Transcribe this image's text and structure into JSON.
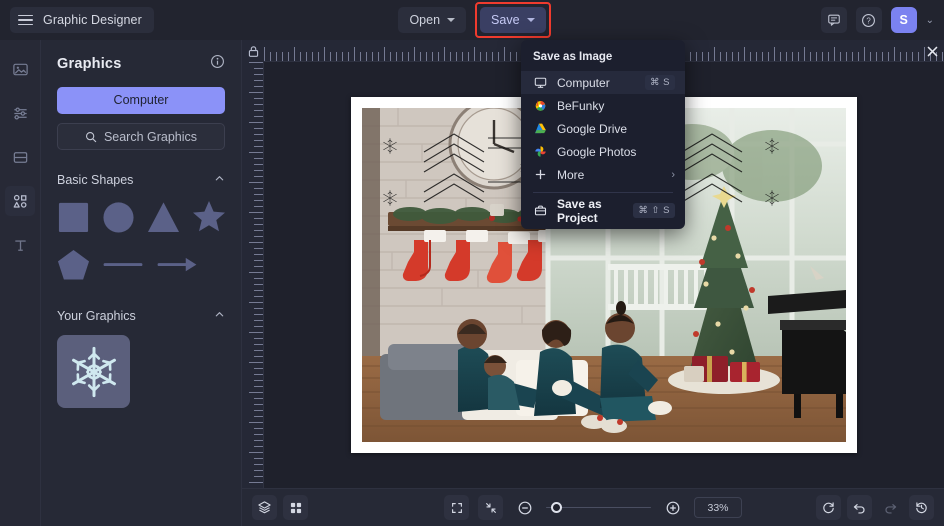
{
  "topbar": {
    "menu_icon": "hamburger-icon",
    "app_title": "Graphic Designer",
    "open_label": "Open",
    "save_label": "Save",
    "feedback_icon": "comment-icon",
    "help_icon": "question-circle-icon",
    "avatar_initial": "S",
    "avatar_caret": "⌄",
    "save_highlight_color": "#f03b2e",
    "save_button_bg": "#3a3f63"
  },
  "rail": {
    "items": [
      {
        "name": "image-tool",
        "icon": "image-icon"
      },
      {
        "name": "adjust-tool",
        "icon": "sliders-icon"
      },
      {
        "name": "frames-tool",
        "icon": "frame-icon"
      },
      {
        "name": "graphics-tool",
        "icon": "shapes-icon"
      },
      {
        "name": "text-tool",
        "icon": "text-icon"
      }
    ]
  },
  "panel": {
    "title": "Graphics",
    "info_icon": "info-icon",
    "computer_button": "Computer",
    "search_icon": "search-icon",
    "search_label": "Search Graphics",
    "sections": [
      {
        "title": "Basic Shapes",
        "chevron": "chevron-up-icon"
      },
      {
        "title": "Your Graphics",
        "chevron": "chevron-up-icon"
      }
    ],
    "basic_shapes": [
      "square-shape",
      "circle-shape",
      "triangle-shape",
      "star-shape",
      "pentagon-shape",
      "line-shape",
      "arrow-shape"
    ],
    "your_graphics": [
      {
        "name": "snowflake-graphic",
        "color": "#cfe8ef"
      }
    ],
    "shape_color": "#5b6188",
    "accent_color": "#8b92f8"
  },
  "ruler": {
    "lock_icon": "lock-icon",
    "close_icon": "close-icon"
  },
  "canvas": {
    "artboard_bg": "#ffffff",
    "photo_alt": "family-christmas-photo"
  },
  "bottombar": {
    "layers_icon": "layers-icon",
    "grid_icon": "grid-icon",
    "fit_icon": "expand-frame-icon",
    "shrink_icon": "collapse-arrows-icon",
    "zoom_out_icon": "minus-circle-icon",
    "zoom_in_icon": "plus-circle-icon",
    "zoom_value": "33%",
    "zoom_percent": 33,
    "reset_icon": "reset-icon",
    "undo_icon": "undo-icon",
    "redo_icon": "redo-icon",
    "history_icon": "history-icon"
  },
  "save_menu": {
    "header": "Save as Image",
    "items": [
      {
        "label": "Computer",
        "icon": "monitor-icon",
        "shortcut": "⌘ S",
        "hover": true
      },
      {
        "label": "BeFunky",
        "icon": "befunky-icon",
        "shortcut": ""
      },
      {
        "label": "Google Drive",
        "icon": "google-drive-icon",
        "shortcut": ""
      },
      {
        "label": "Google Photos",
        "icon": "google-photos-icon",
        "shortcut": ""
      },
      {
        "label": "More",
        "icon": "plus-icon",
        "shortcut": "",
        "arrow": "›"
      }
    ],
    "project": {
      "label": "Save as Project",
      "icon": "briefcase-icon",
      "shortcut": "⌘ ⇧ S"
    }
  }
}
